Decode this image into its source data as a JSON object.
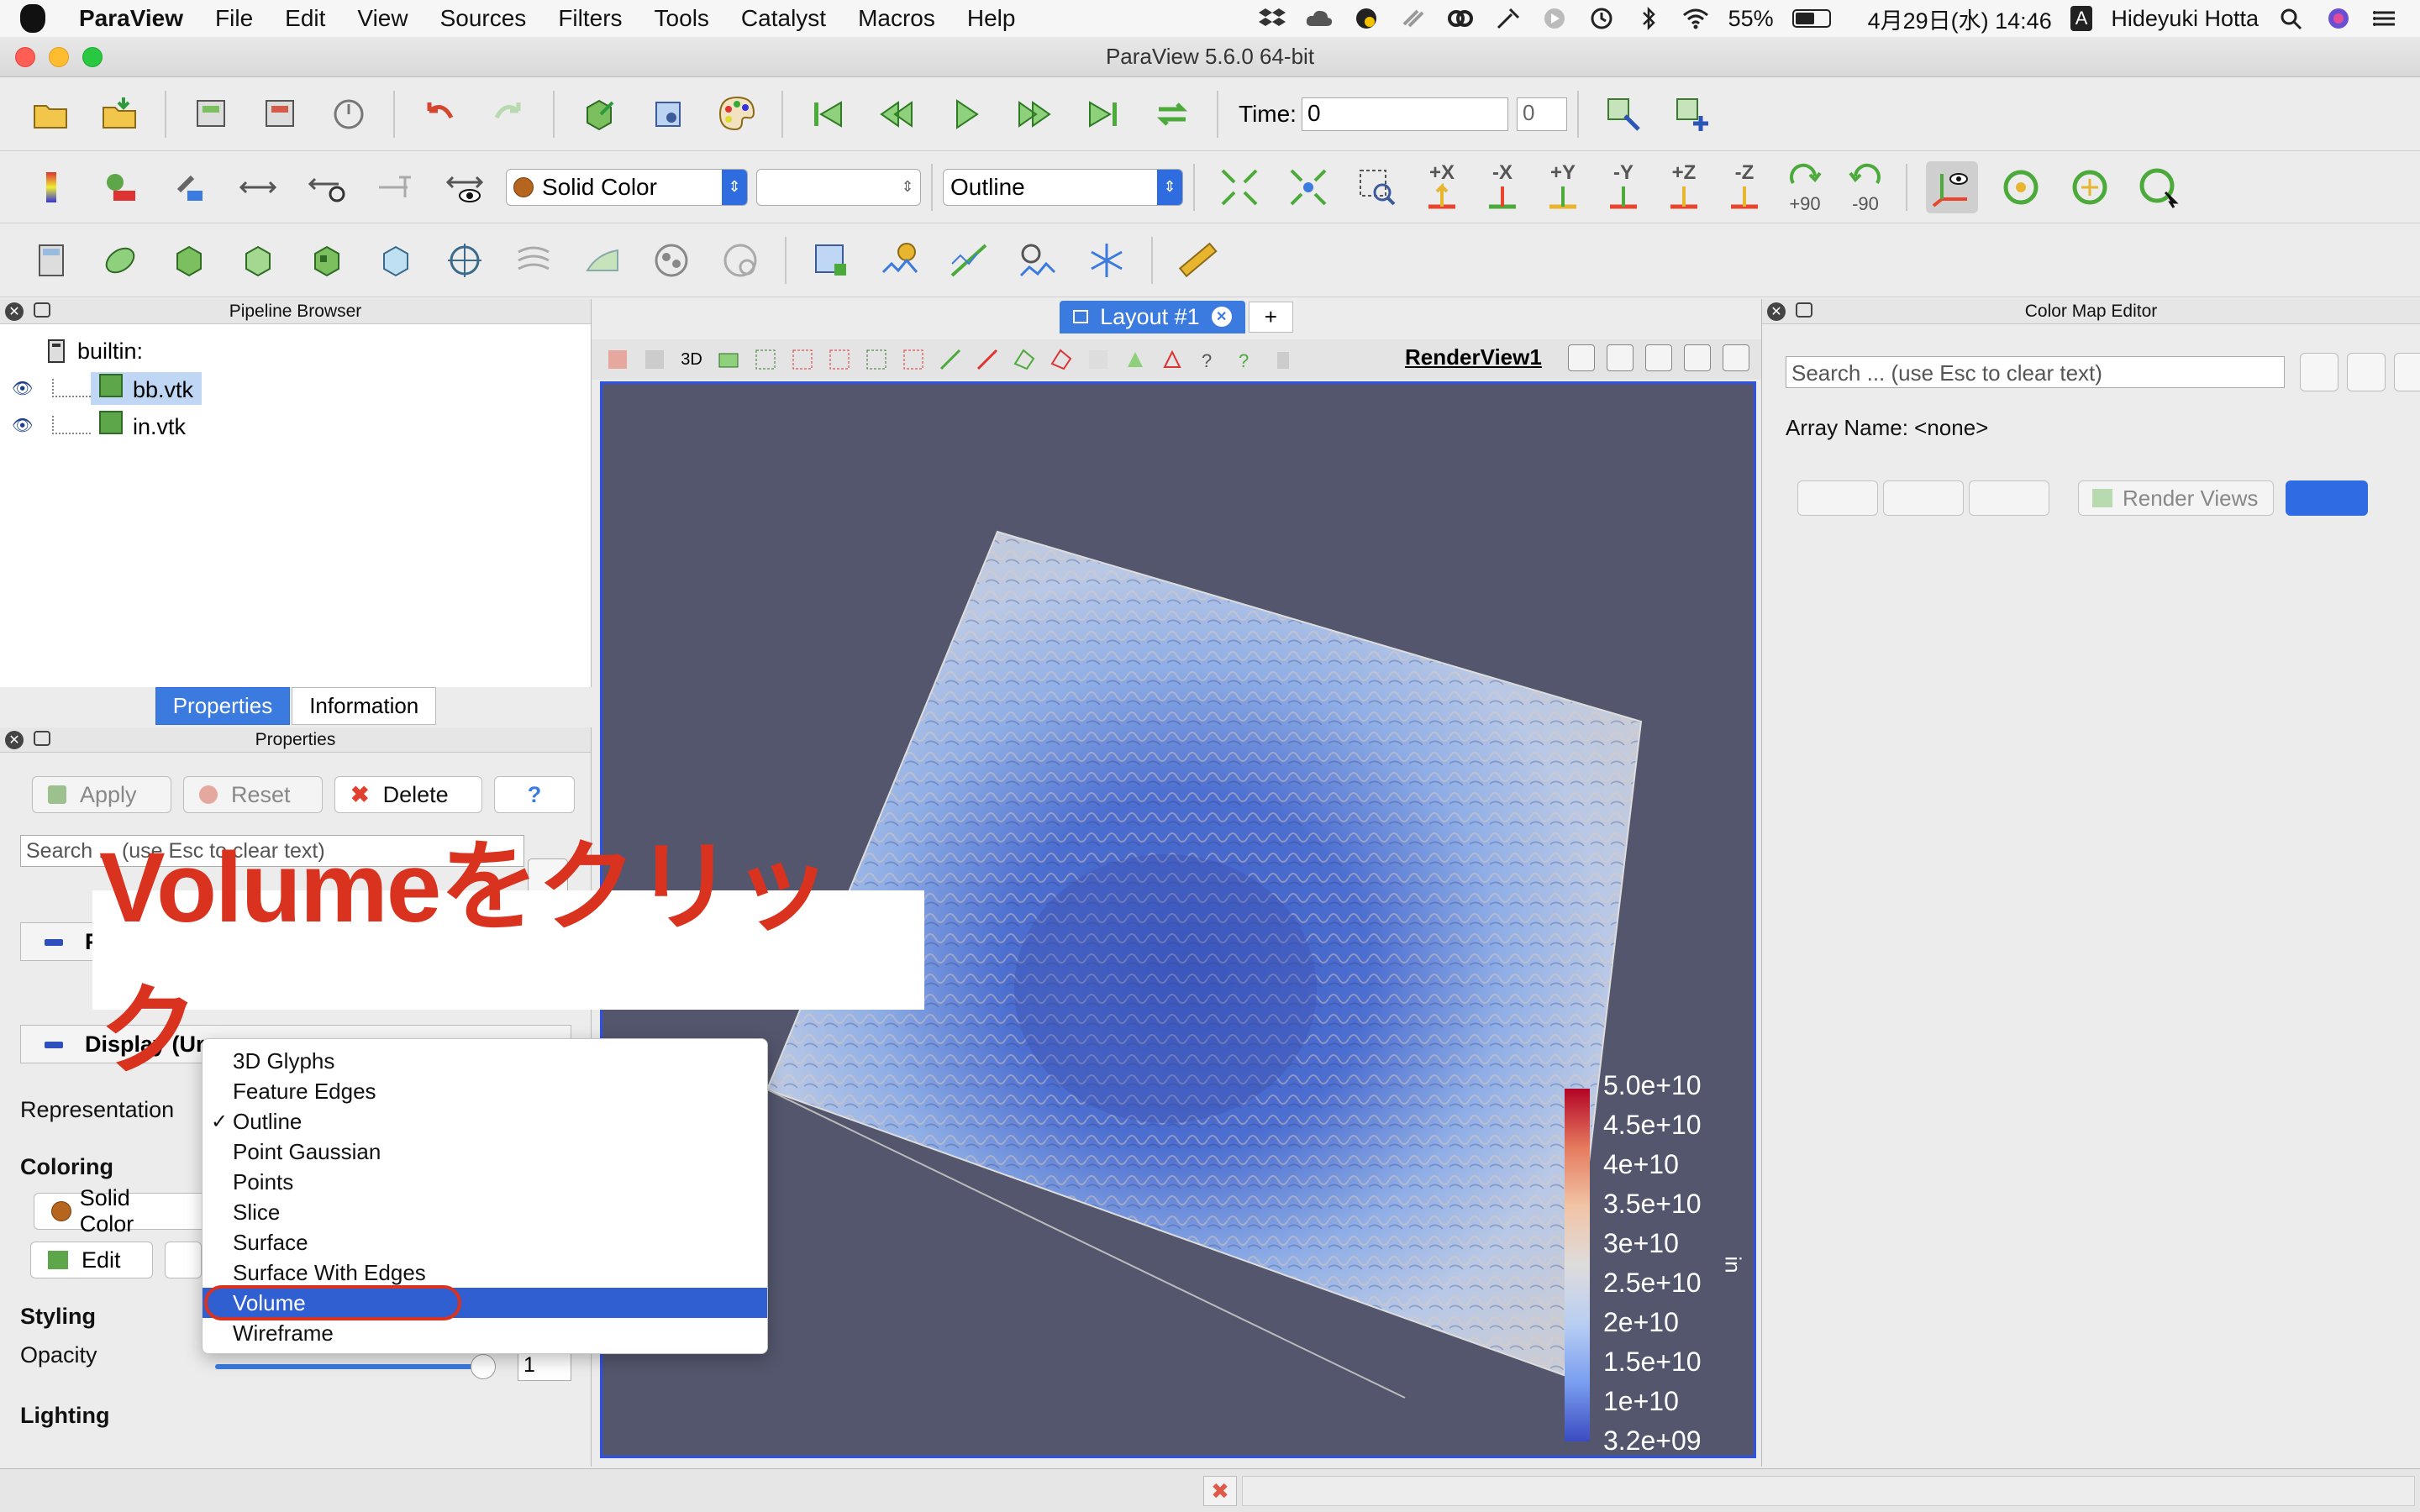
{
  "menubar": {
    "app_name": "ParaView",
    "items": [
      "File",
      "Edit",
      "View",
      "Sources",
      "Filters",
      "Tools",
      "Catalyst",
      "Macros",
      "Help"
    ],
    "battery": "55%",
    "datetime": "4月29日(水) 14:46",
    "input_mode": "A",
    "user": "Hideyuki Hotta"
  },
  "window": {
    "title": "ParaView 5.6.0 64-bit"
  },
  "toolbar1": {
    "time_label": "Time:",
    "time_value": "0",
    "time_index": "0"
  },
  "toolbar2": {
    "color_combo": "Solid Color",
    "component_combo": "",
    "representation_combo": "Outline",
    "axis_buttons": [
      "+X",
      "-X",
      "+Y",
      "-Y",
      "+Z",
      "-Z"
    ],
    "rotate_pos": "+90",
    "rotate_neg": "-90"
  },
  "pipeline": {
    "header": "Pipeline Browser",
    "root": "builtin:",
    "items": [
      {
        "name": "bb.vtk",
        "selected": true
      },
      {
        "name": "in.vtk",
        "selected": false
      }
    ]
  },
  "tabs": {
    "properties": "Properties",
    "information": "Information"
  },
  "properties": {
    "header": "Properties",
    "apply": "Apply",
    "reset": "Reset",
    "delete": "Delete",
    "help": "?",
    "search_placeholder": "Search ... (use Esc to clear text)",
    "section_properties_visible": "P",
    "section_display": "Display (Ur",
    "representation_label": "Representation",
    "coloring_label": "Coloring",
    "coloring_value": "Solid Color",
    "edit_button": "Edit",
    "styling_label": "Styling",
    "opacity_label": "Opacity",
    "opacity_value": "1",
    "opacity_fraction": 1.0,
    "lighting_label": "Lighting"
  },
  "annotation": {
    "text": "Volumeをクリック",
    "color": "#d9321f"
  },
  "dropdown": {
    "items": [
      {
        "label": "3D Glyphs",
        "checked": false,
        "highlight": false
      },
      {
        "label": "Feature Edges",
        "checked": false,
        "highlight": false
      },
      {
        "label": "Outline",
        "checked": true,
        "highlight": false
      },
      {
        "label": "Point Gaussian",
        "checked": false,
        "highlight": false
      },
      {
        "label": "Points",
        "checked": false,
        "highlight": false
      },
      {
        "label": "Slice",
        "checked": false,
        "highlight": false
      },
      {
        "label": "Surface",
        "checked": false,
        "highlight": false
      },
      {
        "label": "Surface With Edges",
        "checked": false,
        "highlight": false
      },
      {
        "label": "Volume",
        "checked": false,
        "highlight": true
      },
      {
        "label": "Wireframe",
        "checked": false,
        "highlight": false
      }
    ],
    "check_mark": "✓"
  },
  "layout": {
    "tab_label": "Layout #1",
    "plus": "+",
    "view_toolbar_3d": "3D",
    "render_view_title": "RenderView1",
    "background_color": "#53566d"
  },
  "legend": {
    "ticks": [
      "5.0e+10",
      "4.5e+10",
      "4e+10",
      "3.5e+10",
      "3e+10",
      "2.5e+10",
      "2e+10",
      "1.5e+10",
      "1e+10",
      "3.2e+09"
    ],
    "variable": "in"
  },
  "color_map_editor": {
    "header": "Color Map Editor",
    "search_placeholder": "Search ... (use Esc to clear text)",
    "array_name": "Array Name: <none>",
    "render_views": "Render Views"
  },
  "colors": {
    "accent_blue": "#3b7be0",
    "highlight_blue": "#2f5fd1",
    "annotation_red": "#d9321f"
  }
}
